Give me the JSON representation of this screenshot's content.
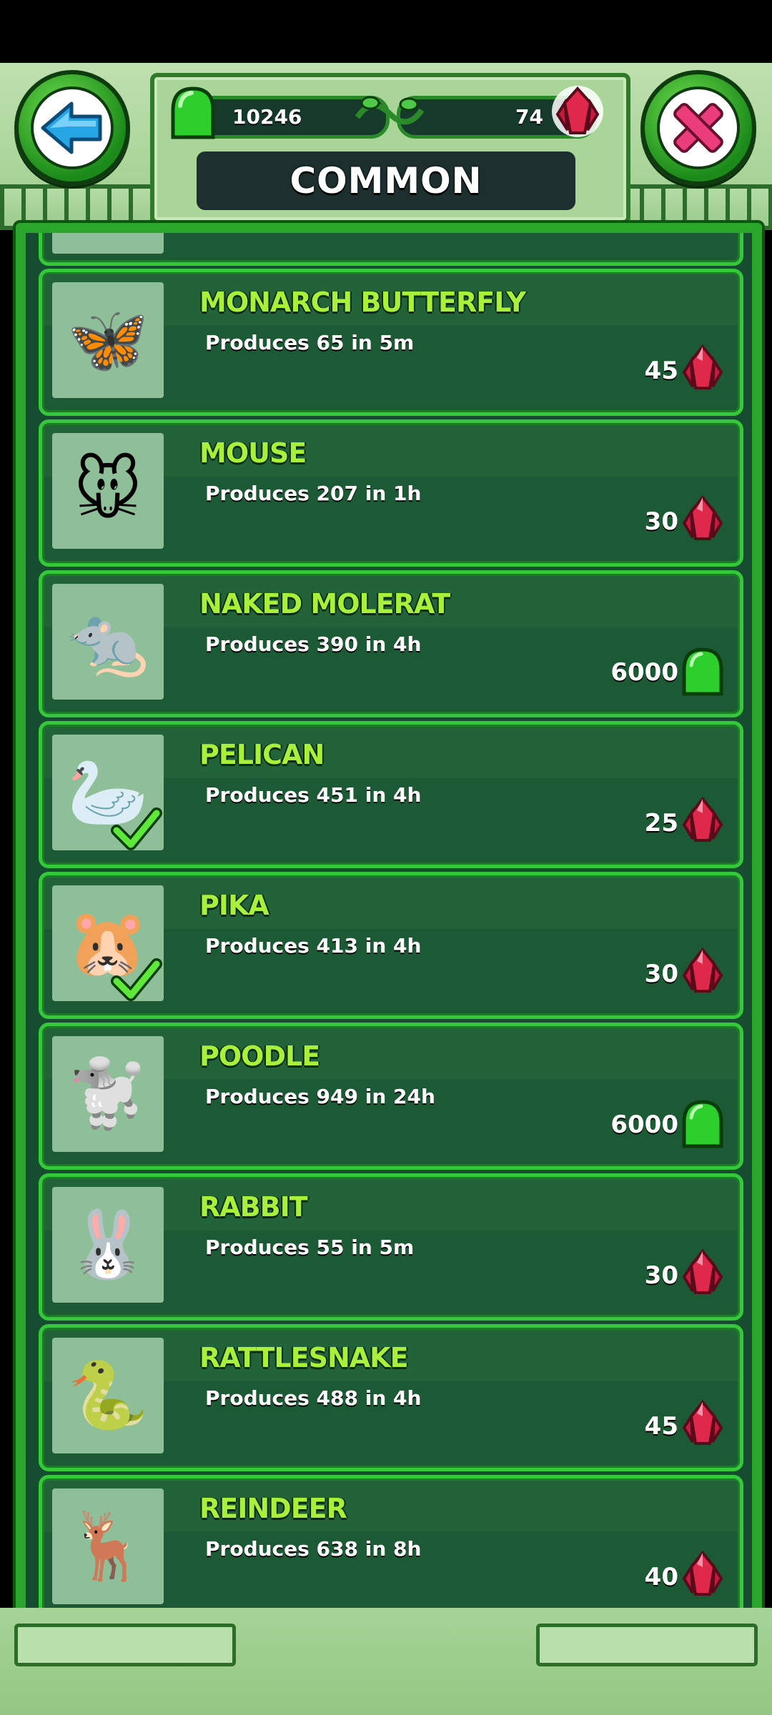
{
  "header": {
    "title": "COMMON",
    "green_gems": "10246",
    "red_gems": "74",
    "back_button": "back",
    "close_button": "close"
  },
  "colors": {
    "accent_green": "#34c83a",
    "name_color": "#a8f03a",
    "ruby": "#e0284a",
    "gum_green": "#2ccf2c"
  },
  "items": [
    {
      "name": "MONARCH BUTTERFLY",
      "produces": "Produces 65 in 5m",
      "price": "45",
      "currency": "ruby-icon",
      "owned": false,
      "icon": "butterfly"
    },
    {
      "name": "MOUSE",
      "produces": "Produces 207 in 1h",
      "price": "30",
      "currency": "ruby-icon",
      "owned": false,
      "icon": "mouse"
    },
    {
      "name": "NAKED MOLERAT",
      "produces": "Produces 390 in 4h",
      "price": "6000",
      "currency": "green-gem-icon",
      "owned": false,
      "icon": "molerat"
    },
    {
      "name": "PELICAN",
      "produces": "Produces 451 in 4h",
      "price": "25",
      "currency": "ruby-icon",
      "owned": true,
      "icon": "pelican"
    },
    {
      "name": "PIKA",
      "produces": "Produces 413 in 4h",
      "price": "30",
      "currency": "ruby-icon",
      "owned": true,
      "icon": "pika"
    },
    {
      "name": "POODLE",
      "produces": "Produces 949 in 24h",
      "price": "6000",
      "currency": "green-gem-icon",
      "owned": false,
      "icon": "poodle"
    },
    {
      "name": "RABBIT",
      "produces": "Produces 55 in 5m",
      "price": "30",
      "currency": "ruby-icon",
      "owned": false,
      "icon": "rabbit"
    },
    {
      "name": "RATTLESNAKE",
      "produces": "Produces 488 in 4h",
      "price": "45",
      "currency": "ruby-icon",
      "owned": false,
      "icon": "rattlesnake"
    },
    {
      "name": "REINDEER",
      "produces": "Produces 638 in 8h",
      "price": "40",
      "currency": "ruby-icon",
      "owned": false,
      "icon": "reindeer"
    }
  ]
}
